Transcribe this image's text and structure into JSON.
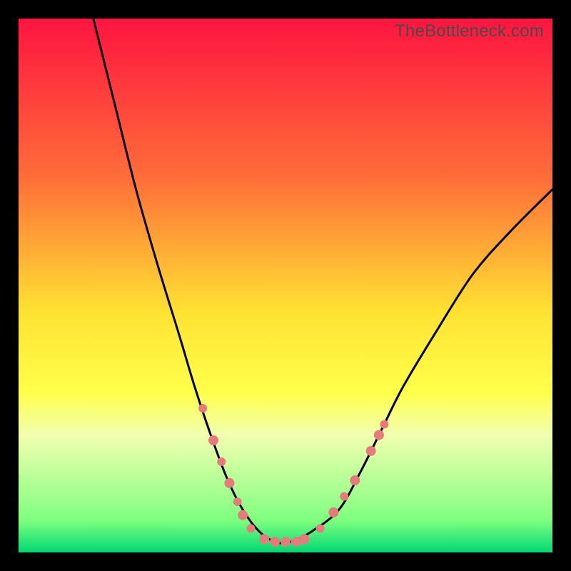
{
  "watermark": "TheBottleneck.com",
  "chart_data": {
    "type": "line",
    "title": "",
    "xlabel": "",
    "ylabel": "",
    "xlim": [
      0,
      100
    ],
    "ylim": [
      0,
      100
    ],
    "gradient_stops": [
      {
        "offset": 0,
        "color": "#ff1440"
      },
      {
        "offset": 30,
        "color": "#ff6e39"
      },
      {
        "offset": 55,
        "color": "#ffe232"
      },
      {
        "offset": 70,
        "color": "#ffff4a"
      },
      {
        "offset": 78,
        "color": "#f2ffb0"
      },
      {
        "offset": 94,
        "color": "#7fff7f"
      },
      {
        "offset": 100,
        "color": "#00d874"
      }
    ],
    "series": [
      {
        "name": "bottleneck-curve",
        "x": [
          14,
          18,
          22,
          26,
          30,
          33,
          36,
          39,
          42,
          45,
          48,
          51,
          55,
          60,
          64,
          68,
          72,
          78,
          85,
          92,
          100
        ],
        "y": [
          100,
          84,
          68,
          54,
          41,
          31,
          22,
          14,
          8,
          4,
          2,
          2,
          4,
          8,
          15,
          23,
          31,
          41,
          52,
          60,
          68
        ]
      }
    ],
    "markers": {
      "name": "highlight-dots",
      "color": "#e77a7a",
      "points": [
        {
          "x": 34.5,
          "y": 27.0,
          "r": 6
        },
        {
          "x": 36.5,
          "y": 21.0,
          "r": 7
        },
        {
          "x": 38.0,
          "y": 17.0,
          "r": 6
        },
        {
          "x": 39.5,
          "y": 13.0,
          "r": 7
        },
        {
          "x": 41.0,
          "y": 9.5,
          "r": 6
        },
        {
          "x": 42.0,
          "y": 7.0,
          "r": 7
        },
        {
          "x": 43.5,
          "y": 4.5,
          "r": 6
        },
        {
          "x": 46.0,
          "y": 2.5,
          "r": 7
        },
        {
          "x": 48.0,
          "y": 2.0,
          "r": 7
        },
        {
          "x": 50.0,
          "y": 2.0,
          "r": 7
        },
        {
          "x": 52.0,
          "y": 2.0,
          "r": 7
        },
        {
          "x": 53.5,
          "y": 2.5,
          "r": 7
        },
        {
          "x": 56.5,
          "y": 4.5,
          "r": 6
        },
        {
          "x": 59.0,
          "y": 7.5,
          "r": 7
        },
        {
          "x": 61.0,
          "y": 10.5,
          "r": 6
        },
        {
          "x": 63.0,
          "y": 13.5,
          "r": 7
        },
        {
          "x": 66.0,
          "y": 19.0,
          "r": 7
        },
        {
          "x": 67.5,
          "y": 22.0,
          "r": 7
        },
        {
          "x": 68.5,
          "y": 24.0,
          "r": 6
        }
      ]
    }
  }
}
